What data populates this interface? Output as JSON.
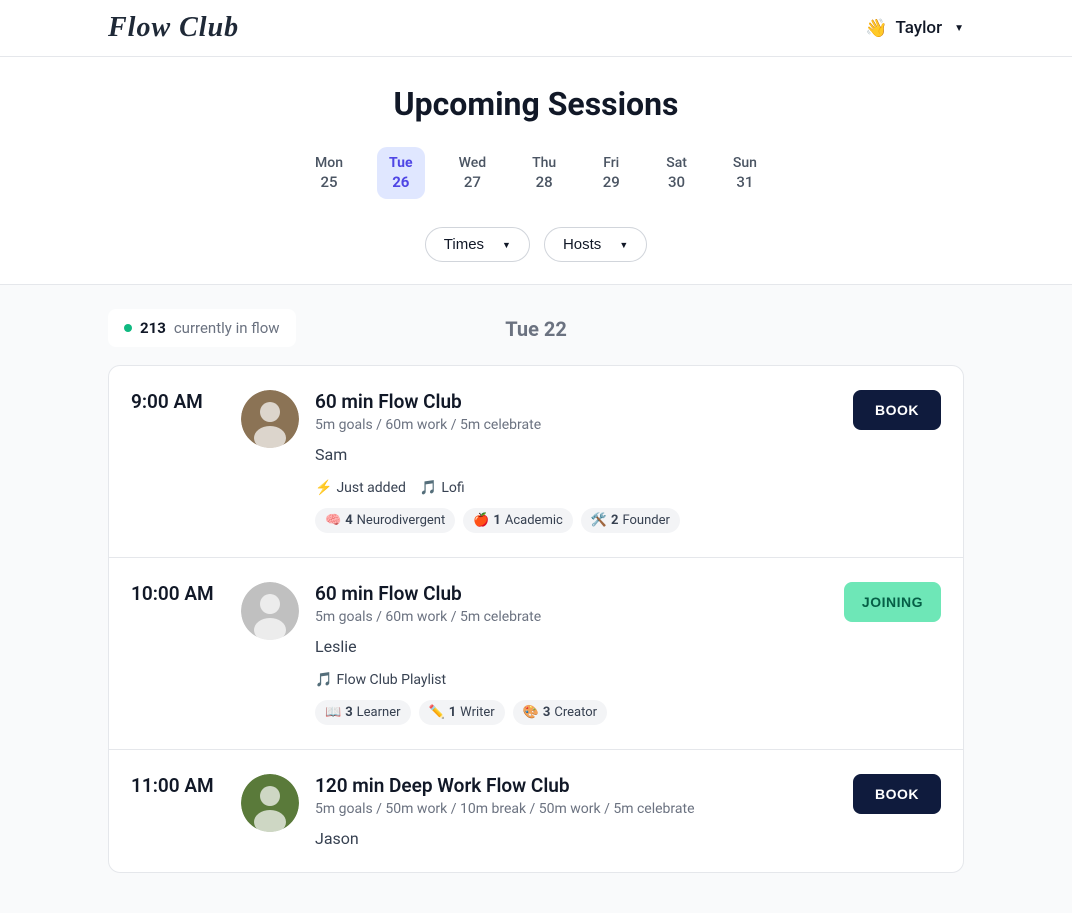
{
  "header": {
    "logo": "Flow Club",
    "user_name": "Taylor",
    "wave_emoji": "👋"
  },
  "page_title": "Upcoming Sessions",
  "dates": [
    {
      "day": "Mon",
      "num": "25",
      "active": false
    },
    {
      "day": "Tue",
      "num": "26",
      "active": true
    },
    {
      "day": "Wed",
      "num": "27",
      "active": false
    },
    {
      "day": "Thu",
      "num": "28",
      "active": false
    },
    {
      "day": "Fri",
      "num": "29",
      "active": false
    },
    {
      "day": "Sat",
      "num": "30",
      "active": false
    },
    {
      "day": "Sun",
      "num": "31",
      "active": false
    }
  ],
  "filters": {
    "times_label": "Times",
    "hosts_label": "Hosts"
  },
  "flow_status": {
    "count": "213",
    "text": "currently in flow"
  },
  "current_date_header": "Tue 22",
  "sessions": [
    {
      "time": "9:00 AM",
      "title": "60 min Flow Club",
      "desc": "5m goals / 60m work / 5m celebrate",
      "host": "Sam",
      "meta": [
        {
          "icon": "⚡",
          "text": "Just added"
        },
        {
          "icon": "🎵",
          "text": "Lofi"
        }
      ],
      "tags": [
        {
          "icon": "🧠",
          "count": "4",
          "label": "Neurodivergent"
        },
        {
          "icon": "🍎",
          "count": "1",
          "label": "Academic"
        },
        {
          "icon": "🛠️",
          "count": "2",
          "label": "Founder"
        }
      ],
      "action": "BOOK",
      "action_type": "book",
      "avatar_bg": "#8b7355"
    },
    {
      "time": "10:00 AM",
      "title": "60 min Flow Club",
      "desc": "5m goals / 60m work / 5m celebrate",
      "host": "Leslie",
      "meta": [
        {
          "icon": "🎵",
          "text": "Flow Club Playlist"
        }
      ],
      "tags": [
        {
          "icon": "📖",
          "count": "3",
          "label": "Learner"
        },
        {
          "icon": "✏️",
          "count": "1",
          "label": "Writer"
        },
        {
          "icon": "🎨",
          "count": "3",
          "label": "Creator"
        }
      ],
      "action": "JOINING",
      "action_type": "joining",
      "avatar_bg": "#c0c0c0"
    },
    {
      "time": "11:00 AM",
      "title": "120 min Deep Work Flow Club",
      "desc": "5m goals / 50m work / 10m break /  50m work / 5m celebrate",
      "host": "Jason",
      "meta": [],
      "tags": [],
      "action": "BOOK",
      "action_type": "book",
      "avatar_bg": "#5a7a3a"
    }
  ]
}
